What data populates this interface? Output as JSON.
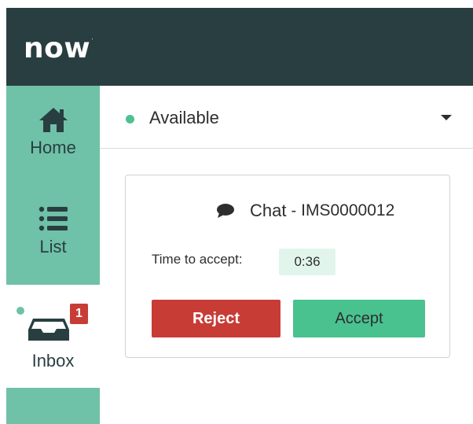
{
  "header": {
    "logo_text": "now",
    "logo_mark": "."
  },
  "sidebar": {
    "items": [
      {
        "label": "Home",
        "icon": "home-icon"
      },
      {
        "label": "List",
        "icon": "list-icon"
      },
      {
        "label": "Inbox",
        "icon": "inbox-icon",
        "badge": "1",
        "active": true
      }
    ]
  },
  "status": {
    "label": "Available",
    "dot_color": "#4bc28f"
  },
  "card": {
    "icon": "chat-bubble-icon",
    "type": "Chat",
    "separator": "-",
    "id": "IMS0000012",
    "time_label": "Time to accept:",
    "time_value": "0:36",
    "reject_label": "Reject",
    "accept_label": "Accept"
  },
  "colors": {
    "header_bg": "#293e40",
    "sidebar_bg": "#6fc1a7",
    "reject": "#c83c36",
    "accept": "#49c28f",
    "badge": "#c83c36",
    "timer_bg": "#e2f5ec"
  }
}
